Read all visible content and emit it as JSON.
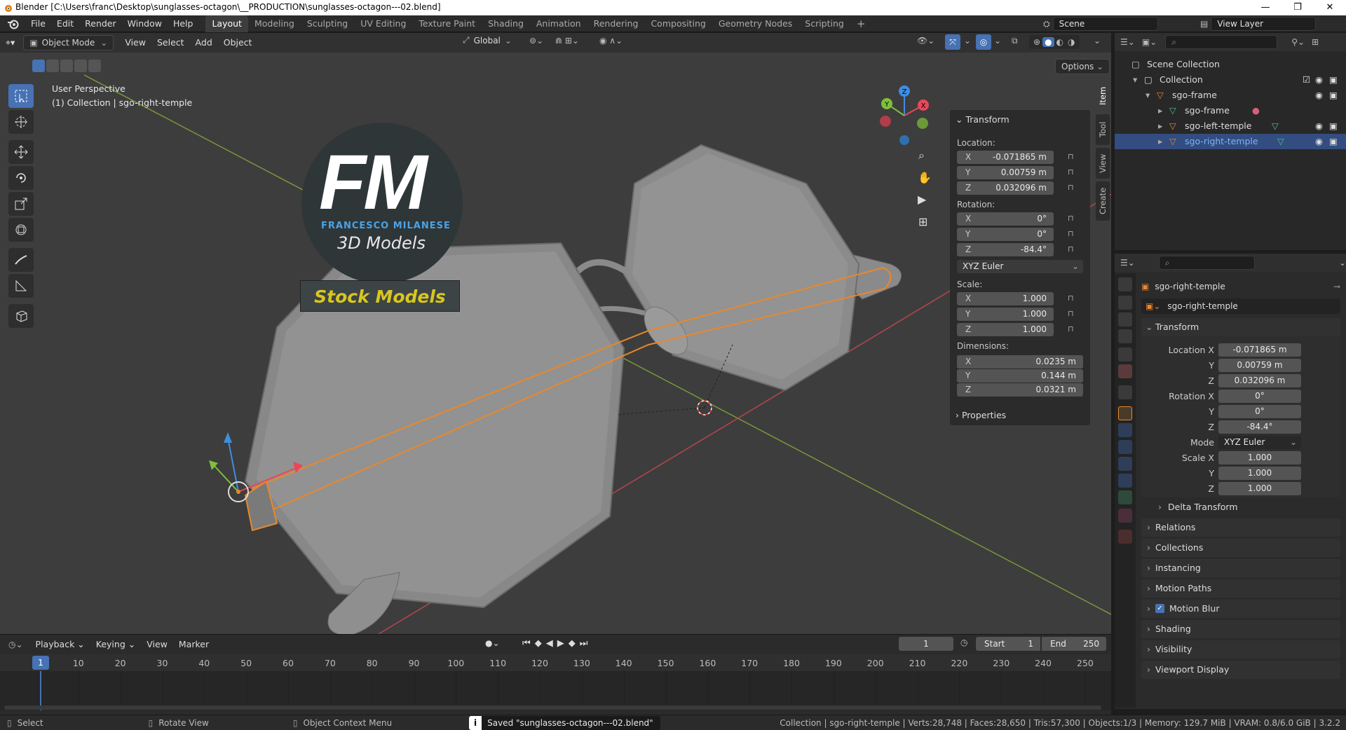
{
  "window": {
    "title": "Blender [C:\\Users\\franc\\Desktop\\sunglasses-octagon\\__PRODUCTION\\sunglasses-octagon---02.blend]",
    "minimize": "—",
    "maximize": "❐",
    "close": "✕"
  },
  "menu": {
    "items": [
      "File",
      "Edit",
      "Render",
      "Window",
      "Help"
    ],
    "workspaces": [
      "Layout",
      "Modeling",
      "Sculpting",
      "UV Editing",
      "Texture Paint",
      "Shading",
      "Animation",
      "Rendering",
      "Compositing",
      "Geometry Nodes",
      "Scripting"
    ],
    "add_tab": "+",
    "scene": "Scene",
    "view_layer": "View Layer"
  },
  "viewport": {
    "mode": "Object Mode",
    "menus": [
      "View",
      "Select",
      "Add",
      "Object"
    ],
    "orientation": "Global",
    "options": "Options",
    "info_line1": "User Perspective",
    "info_line2": "(1) Collection | sgo-right-temple",
    "logo_letters": "FM",
    "logo_name": "FRANCESCO MILANESE",
    "logo_sub": "3D Models",
    "logo_banner": "Stock Models",
    "gizmo_axes": {
      "x": "X",
      "y": "Y",
      "z": "Z"
    }
  },
  "npanel": {
    "header": "Transform",
    "location_label": "Location:",
    "location": [
      {
        "axis": "X",
        "value": "-0.071865 m"
      },
      {
        "axis": "Y",
        "value": "0.00759 m"
      },
      {
        "axis": "Z",
        "value": "0.032096 m"
      }
    ],
    "rotation_label": "Rotation:",
    "rotation": [
      {
        "axis": "X",
        "value": "0°"
      },
      {
        "axis": "Y",
        "value": "0°"
      },
      {
        "axis": "Z",
        "value": "-84.4°"
      }
    ],
    "rotation_mode": "XYZ Euler",
    "scale_label": "Scale:",
    "scale": [
      {
        "axis": "X",
        "value": "1.000"
      },
      {
        "axis": "Y",
        "value": "1.000"
      },
      {
        "axis": "Z",
        "value": "1.000"
      }
    ],
    "dimensions_label": "Dimensions:",
    "dimensions": [
      {
        "axis": "X",
        "value": "0.0235 m"
      },
      {
        "axis": "Y",
        "value": "0.144 m"
      },
      {
        "axis": "Z",
        "value": "0.0321 m"
      }
    ],
    "properties": "Properties",
    "tabs": [
      "Item",
      "Tool",
      "View",
      "Create"
    ]
  },
  "outliner": {
    "scene_collection": "Scene Collection",
    "collection": "Collection",
    "items": [
      "sgo-frame",
      "sgo-frame",
      "sgo-left-temple",
      "sgo-right-temple"
    ]
  },
  "properties": {
    "object_name": "sgo-right-temple",
    "datablock": "sgo-right-temple",
    "transform": "Transform",
    "location_label": "Location X",
    "location": [
      "-0.071865 m",
      "0.00759 m",
      "0.032096 m"
    ],
    "rotation_label": "Rotation X",
    "rotation": [
      "0°",
      "0°",
      "-84.4°"
    ],
    "mode_label": "Mode",
    "mode": "XYZ Euler",
    "scale_label": "Scale X",
    "scale": [
      "1.000",
      "1.000",
      "1.000"
    ],
    "axis_y": "Y",
    "axis_z": "Z",
    "sections": [
      "Delta Transform",
      "Relations",
      "Collections",
      "Instancing",
      "Motion Paths",
      "Motion Blur",
      "Shading",
      "Visibility",
      "Viewport Display"
    ]
  },
  "timeline": {
    "menus": [
      "Playback",
      "Keying",
      "View",
      "Marker"
    ],
    "current_frame": "1",
    "start_label": "Start",
    "start": "1",
    "end_label": "End",
    "end": "250",
    "ticks": [
      "10",
      "20",
      "30",
      "40",
      "50",
      "60",
      "70",
      "80",
      "90",
      "100",
      "110",
      "120",
      "130",
      "140",
      "150",
      "160",
      "170",
      "180",
      "190",
      "200",
      "210",
      "220",
      "230",
      "240",
      "250"
    ],
    "playhead": "1"
  },
  "status": {
    "select": "Select",
    "rotate": "Rotate View",
    "context": "Object Context Menu",
    "message": "Saved \"sunglasses-octagon---02.blend\"",
    "stats": "Collection | sgo-right-temple | Verts:28,748 | Faces:28,650 | Tris:57,300 | Objects:1/3 | Memory: 129.7 MiB | VRAM: 0.8/6.0 GiB | 3.2.2"
  },
  "colors": {
    "accent": "#4772b3",
    "selected_text": "#7db3ff",
    "object_orange": "#e8882c",
    "mesh_green": "#4fc28a",
    "axis_red": "#e8475a",
    "axis_green": "#7fbf3c",
    "axis_blue": "#3f8ee0"
  }
}
